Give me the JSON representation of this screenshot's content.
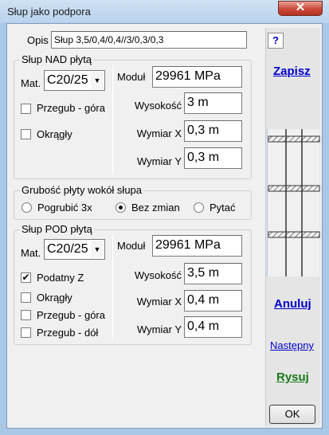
{
  "window": {
    "title": "Słup jako podpora",
    "close_glyph": "✕"
  },
  "header": {
    "opis_label": "Opis",
    "opis_value": "Słup 3,5/0,4/0,4//3/0,3/0,3"
  },
  "nad": {
    "legend": "Słup NAD płytą",
    "mat_label": "Mat.",
    "mat_value": "C20/25",
    "modul_label": "Moduł",
    "modul_value": "29961 MPa",
    "przegub_gora_label": "Przegub - góra",
    "okragly_label": "Okrągły",
    "wysokosc_label": "Wysokość",
    "wysokosc_value": "3 m",
    "wymiar_x_label": "Wymiar X",
    "wymiar_x_value": "0,3 m",
    "wymiar_y_label": "Wymiar Y",
    "wymiar_y_value": "0,3 m"
  },
  "grubosc": {
    "legend": "Grubość płyty wokół słupa",
    "options": [
      "Pogrubić 3x",
      "Bez zmian",
      "Pytać"
    ],
    "selected": "Bez zmian"
  },
  "pod": {
    "legend": "Słup POD płytą",
    "mat_label": "Mat.",
    "mat_value": "C20/25",
    "modul_label": "Moduł",
    "modul_value": "29961 MPa",
    "podatny_z_label": "Podatny Z",
    "podatny_z_checked": true,
    "okragly_label": "Okrągły",
    "przegub_gora_label": "Przegub - góra",
    "przegub_dol_label": "Przegub - dół",
    "wysokosc_label": "Wysokość",
    "wysokosc_value": "3,5 m",
    "wymiar_x_label": "Wymiar X",
    "wymiar_x_value": "0,4 m",
    "wymiar_y_label": "Wymiar Y",
    "wymiar_y_value": "0,4 m"
  },
  "right_panel": {
    "help_label": "?",
    "zapisz": "Zapisz",
    "anuluj": "Anuluj",
    "nastepny": "Następny",
    "rysuj": "Rysuj",
    "ok": "OK",
    "colors": {
      "link_blue": "#0000cc",
      "rysuj_green": "#1a7a1a"
    }
  }
}
